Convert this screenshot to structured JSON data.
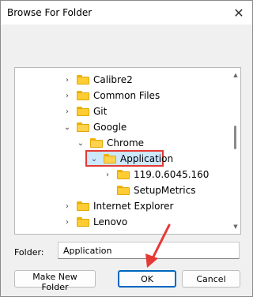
{
  "window": {
    "title": "Browse For Folder",
    "close_glyph": "✕"
  },
  "tree": {
    "items": [
      {
        "label": "Calibre2",
        "chevron": "›"
      },
      {
        "label": "Common Files",
        "chevron": "›"
      },
      {
        "label": "Git",
        "chevron": "›"
      },
      {
        "label": "Google",
        "chevron": "⌄"
      },
      {
        "label": "Chrome",
        "chevron": "⌄"
      },
      {
        "label": "Application",
        "chevron": "⌄"
      },
      {
        "label": "119.0.6045.160",
        "chevron": "›"
      },
      {
        "label": "SetupMetrics",
        "chevron": ""
      },
      {
        "label": "Internet Explorer",
        "chevron": "›"
      },
      {
        "label": "Lenovo",
        "chevron": "›"
      }
    ]
  },
  "folder_field": {
    "label": "Folder:",
    "value": "Application"
  },
  "buttons": {
    "new_folder": "Make New Folder",
    "ok": "OK",
    "cancel": "Cancel"
  },
  "colors": {
    "selection_border": "#e53935",
    "annotation_arrow": "#e53935",
    "ok_border": "#0067c0"
  }
}
